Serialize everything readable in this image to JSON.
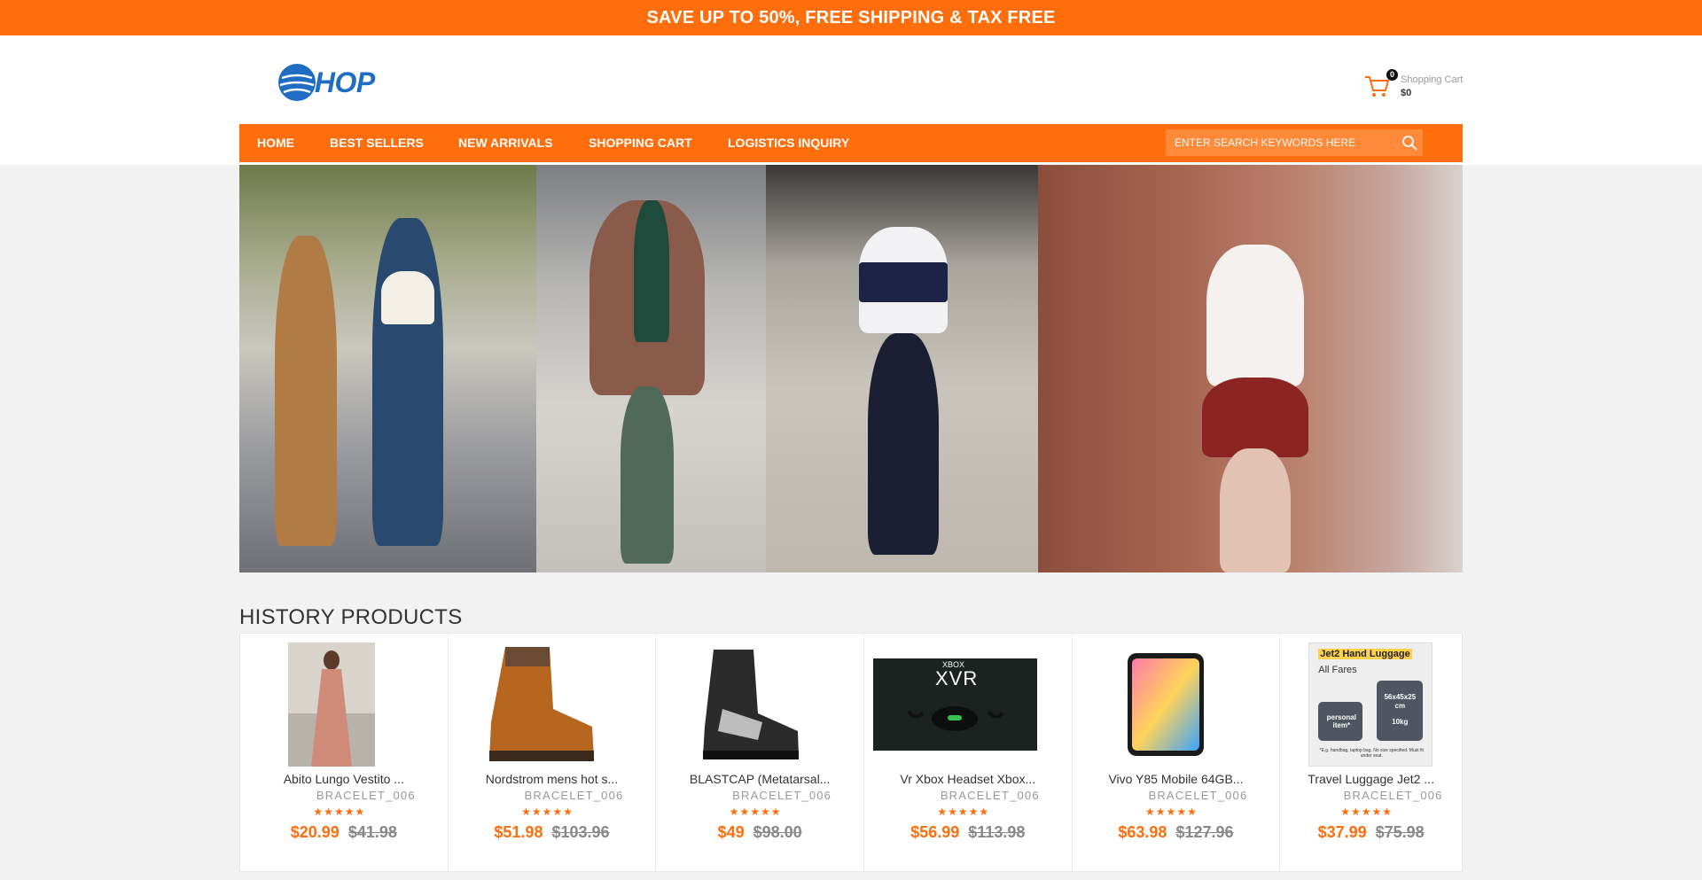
{
  "promo": {
    "text": "SAVE UP TO 50%, FREE SHIPPING & TAX FREE"
  },
  "logo": {
    "text": "SHOP"
  },
  "cart": {
    "count": "0",
    "label": "Shopping Cart",
    "total": "$0"
  },
  "nav": {
    "items": [
      {
        "label": "HOME"
      },
      {
        "label": "BEST SELLERS"
      },
      {
        "label": "NEW ARRIVALS"
      },
      {
        "label": "SHOPPING CART"
      },
      {
        "label": "LOGISTICS INQUIRY"
      }
    ],
    "search_placeholder": "ENTER SEARCH KEYWORDS HERE"
  },
  "history": {
    "title": "HISTORY PRODUCTS",
    "products": [
      {
        "name": "Abito Lungo Vestito ...",
        "brand": "BRACELET_006",
        "stars": "★★★★★",
        "price": "$20.99",
        "old_price": "$41.98"
      },
      {
        "name": "Nordstrom mens hot s...",
        "brand": "BRACELET_006",
        "stars": "★★★★★",
        "price": "$51.98",
        "old_price": "$103.96"
      },
      {
        "name": "BLASTCAP (Metatarsal...",
        "brand": "BRACELET_006",
        "stars": "★★★★★",
        "price": "$49",
        "old_price": "$98.00"
      },
      {
        "name": "Vr Xbox Headset Xbox...",
        "brand": "BRACELET_006",
        "stars": "★★★★★",
        "price": "$56.99",
        "old_price": "$113.98"
      },
      {
        "name": "Vivo Y85 Mobile 64GB...",
        "brand": "BRACELET_006",
        "stars": "★★★★★",
        "price": "$63.98",
        "old_price": "$127.96"
      },
      {
        "name": "Travel Luggage Jet2 ...",
        "brand": "BRACELET_006",
        "stars": "★★★★★",
        "price": "$37.99",
        "old_price": "$75.98"
      }
    ],
    "image_texts": {
      "xbox_brand": "XBOX",
      "xbox_model": "XVR",
      "luggage_title": "Jet2 Hand Luggage",
      "luggage_fares": "All Fares",
      "luggage_personal": "personal item*",
      "luggage_size": "56x45x25 cm",
      "luggage_weight": "10kg",
      "luggage_note": "*E.g. handbag, laptop bag. No size specified. Must fit under seat."
    }
  },
  "colors": {
    "accent": "#ff6e0c",
    "logo_blue": "#1f6ec4"
  }
}
